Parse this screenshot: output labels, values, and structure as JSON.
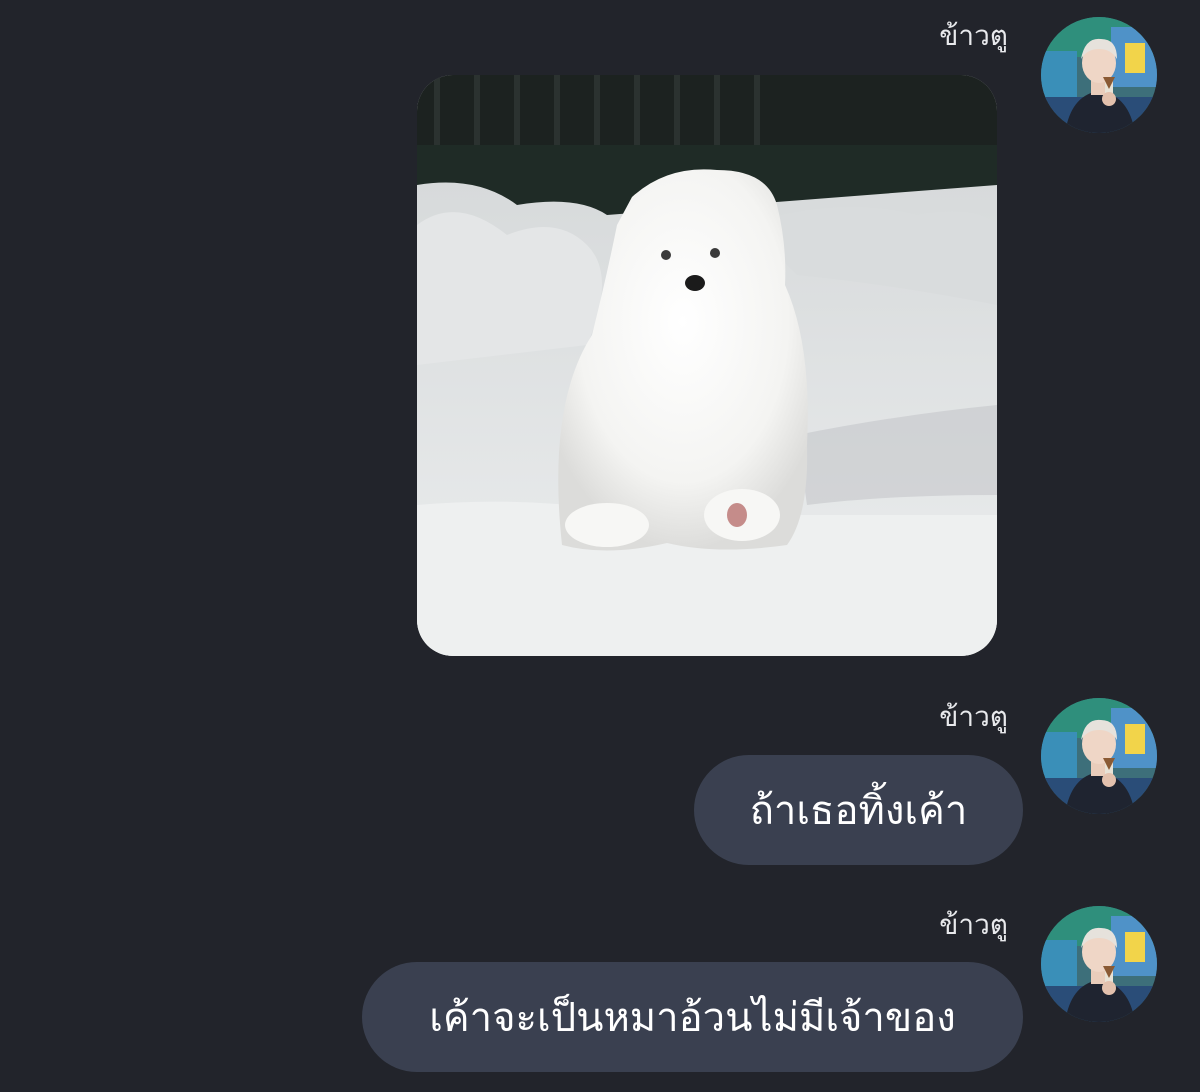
{
  "messages": [
    {
      "sender": "ข้าวตู",
      "type": "image",
      "image_icon": "samoyed-puppy-in-snow-photo",
      "avatar_icon": "user-avatar-photo"
    },
    {
      "sender": "ข้าวตู",
      "type": "text",
      "text": "ถ้าเธอทิ้งเค้า",
      "avatar_icon": "user-avatar-photo"
    },
    {
      "sender": "ข้าวตู",
      "type": "text",
      "text": "เค้าจะเป็นหมาอ้วนไม่มีเจ้าของ",
      "avatar_icon": "user-avatar-photo"
    }
  ],
  "colors": {
    "background": "#22242b",
    "bubble": "#3a4050",
    "text": "#ffffff",
    "sender_name": "#e8e9ec"
  }
}
